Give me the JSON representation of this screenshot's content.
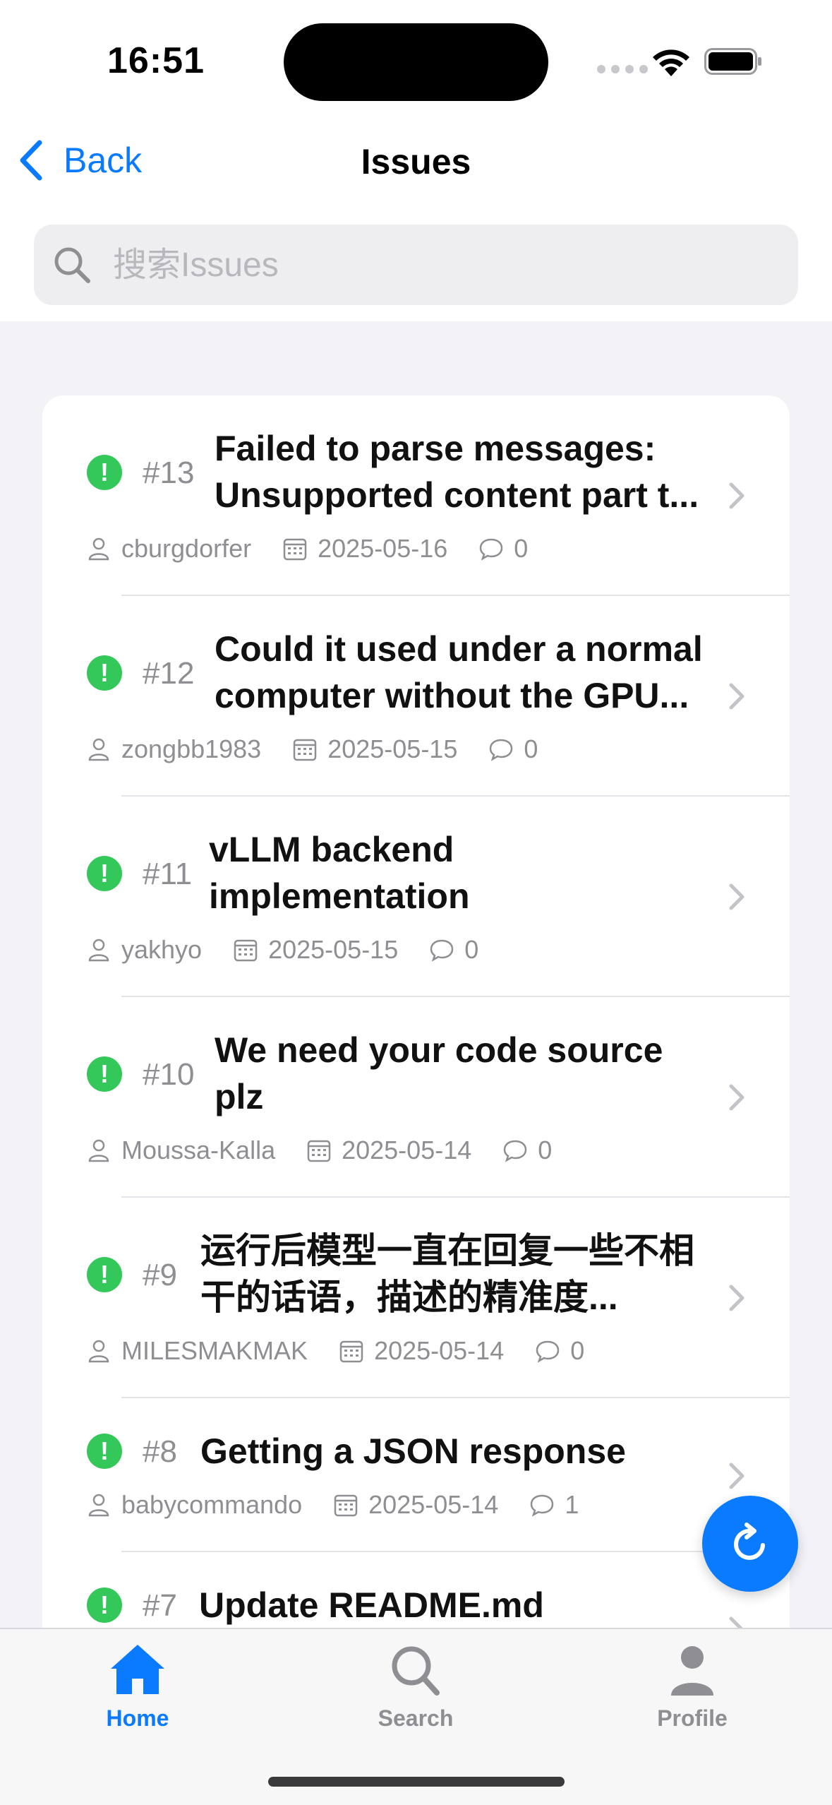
{
  "status_bar": {
    "time": "16:51"
  },
  "nav": {
    "back_label": "Back",
    "title": "Issues"
  },
  "search": {
    "placeholder": "搜索Issues"
  },
  "issues": [
    {
      "number": "#13",
      "title": "Failed to parse messages: Unsupported content part t...",
      "author": "cburgdorfer",
      "date": "2025-05-16",
      "comments": "0",
      "status_color": "#34c759"
    },
    {
      "number": "#12",
      "title": "Could it used under a normal computer without the GPU...",
      "author": "zongbb1983",
      "date": "2025-05-15",
      "comments": "0",
      "status_color": "#34c759"
    },
    {
      "number": "#11",
      "title": "vLLM backend implementation",
      "author": "yakhyo",
      "date": "2025-05-15",
      "comments": "0",
      "status_color": "#34c759"
    },
    {
      "number": "#10",
      "title": "We need your code source plz",
      "author": "Moussa-Kalla",
      "date": "2025-05-14",
      "comments": "0",
      "status_color": "#34c759"
    },
    {
      "number": "#9",
      "title": "运行后模型一直在回复一些不相干的话语，描述的精准度...",
      "author": "MILESMAKMAK",
      "date": "2025-05-14",
      "comments": "0",
      "status_color": "#34c759"
    },
    {
      "number": "#8",
      "title": "Getting a JSON response",
      "author": "babycommando",
      "date": "2025-05-14",
      "comments": "1",
      "status_color": "#34c759"
    },
    {
      "number": "#7",
      "title": "Update README.md",
      "author": "",
      "date": "",
      "comments": "",
      "status_color": "#34c759"
    }
  ],
  "tabs": {
    "home": "Home",
    "search": "Search",
    "profile": "Profile"
  },
  "colors": {
    "accent": "#0a7aff",
    "open_status": "#34c759",
    "secondary_text": "#8e8e93"
  },
  "icons": [
    "back-chevron-icon",
    "search-icon",
    "open-issue-icon",
    "person-icon",
    "calendar-icon",
    "comment-icon",
    "chevron-right-icon",
    "refresh-icon",
    "home-icon",
    "search-tab-icon",
    "profile-icon"
  ]
}
